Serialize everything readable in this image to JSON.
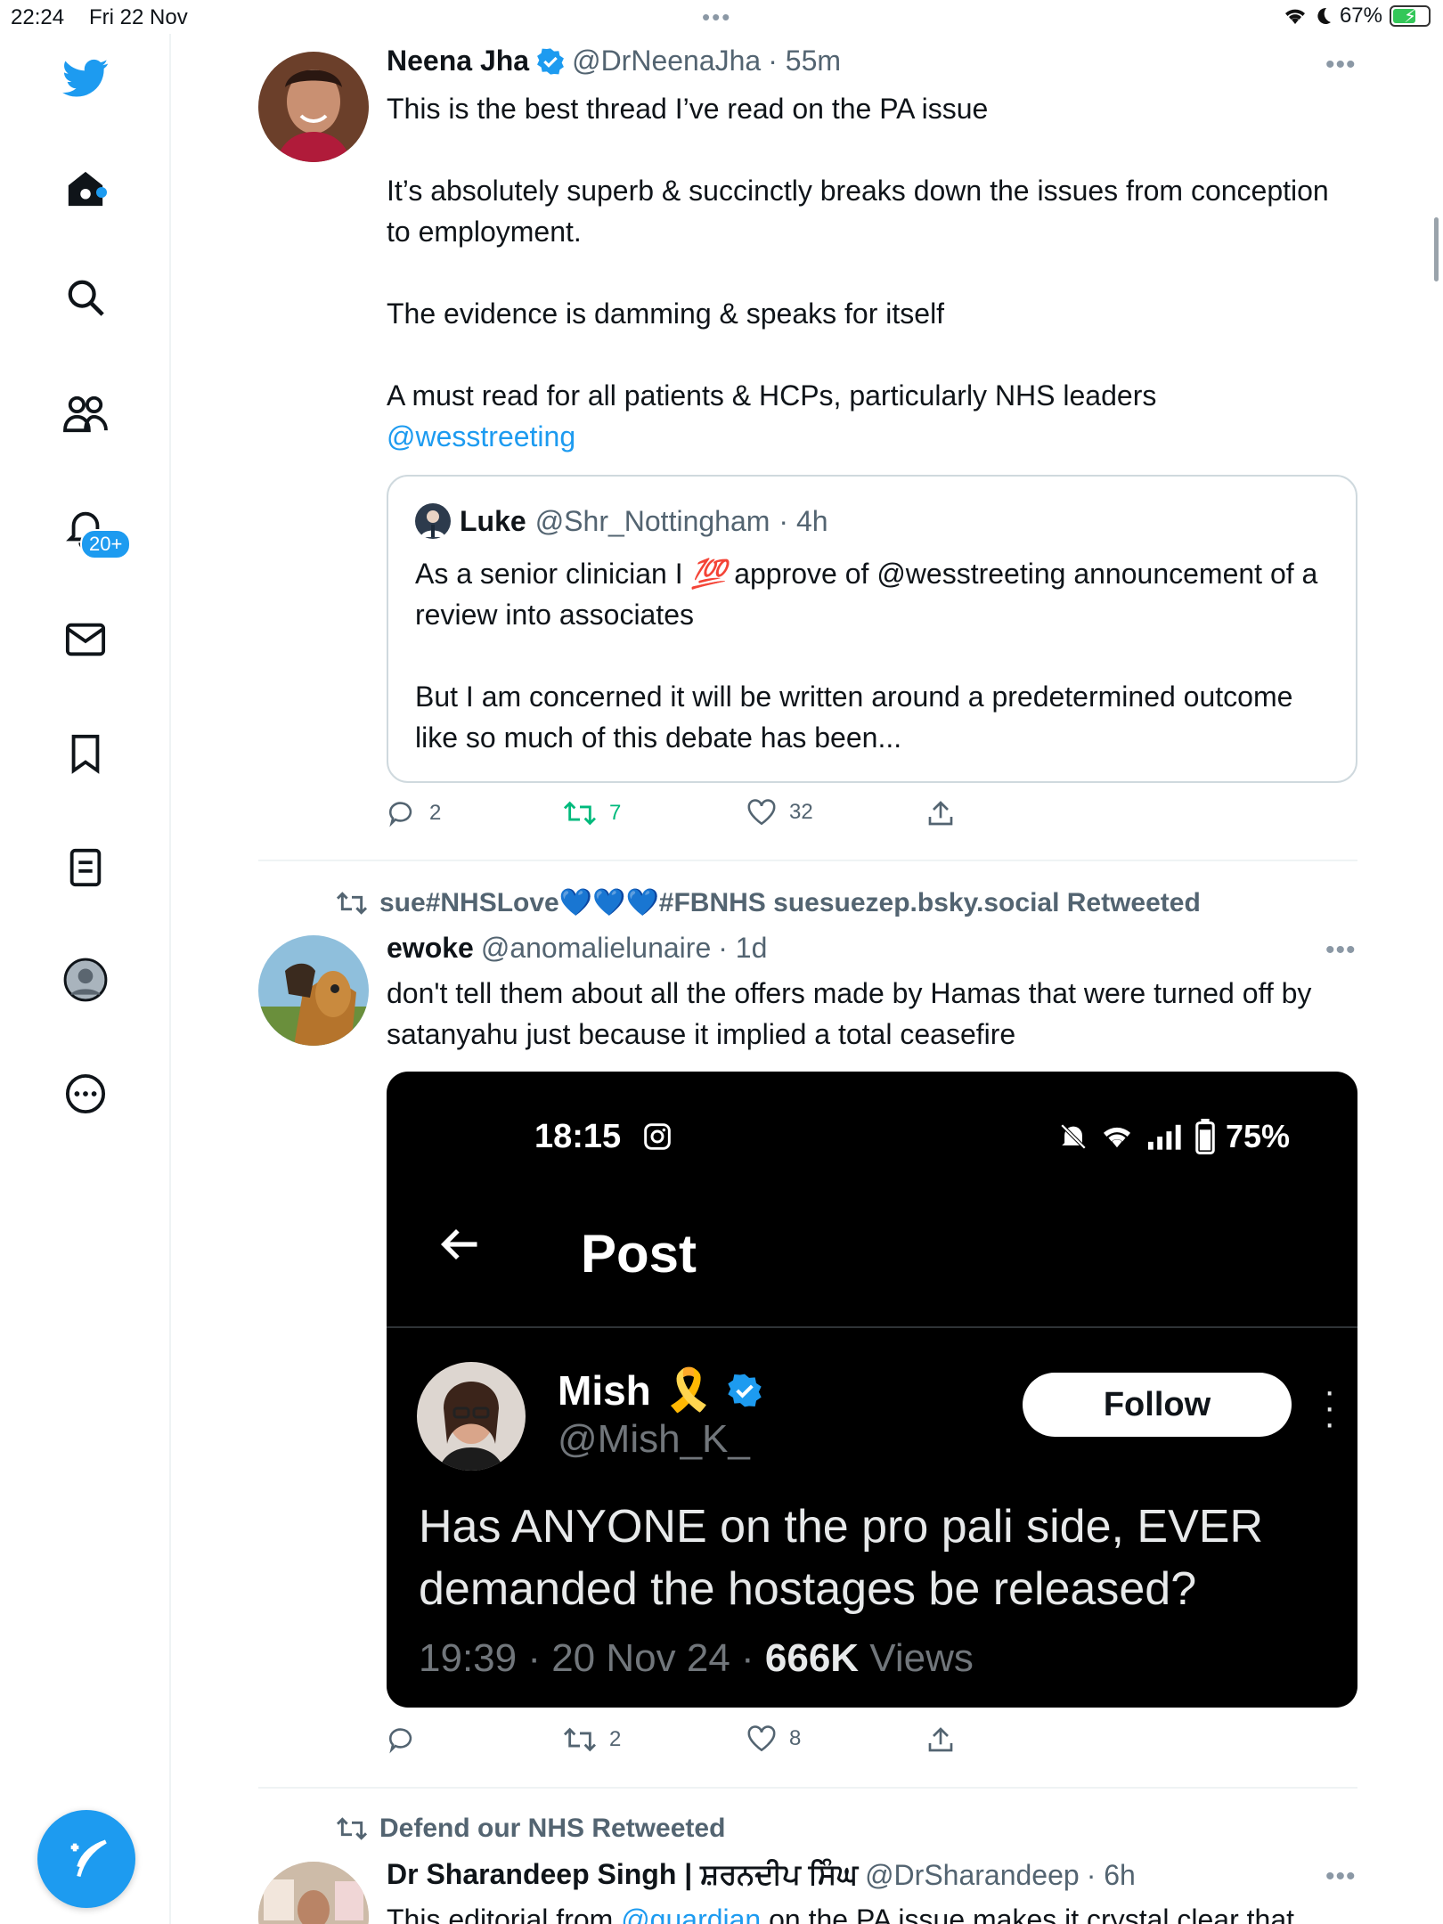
{
  "status_bar": {
    "time": "22:24",
    "date": "Fri 22 Nov",
    "dots": "•••",
    "battery": "67%",
    "battery_level": 0.67
  },
  "sidebar": {
    "notifications_badge": "20+"
  },
  "colors": {
    "brand": "#1d9bf0",
    "retweet_active": "#00ba7c",
    "muted": "#536471"
  },
  "tweets": [
    {
      "name": "Neena Jha",
      "handle": "@DrNeenaJha",
      "time": "· 55m",
      "text": [
        "This is the best thread I’ve read on the PA issue",
        "It’s absolutely superb & succinctly breaks down the issues from conception to employment.",
        "The evidence is damming & speaks for itself",
        "A must read for all patients & HCPs, particularly NHS leaders"
      ],
      "mention": "@wesstreeting",
      "quote": {
        "name": "Luke",
        "handle": "@Shr_Nottingham",
        "time": "· 4h",
        "text_1_pre": "As a senior clinician I ",
        "emoji": "💯",
        "text_1_post": " approve of @wesstreeting announcement of a review into associates",
        "text_2": "But I am concerned it will be written around a predetermined outcome like so much of this debate has been..."
      },
      "replies": "2",
      "retweets": "7",
      "likes": "32"
    },
    {
      "retweeted_by": "sue#NHSLove💙💙💙#FBNHS suesuezep.bsky.social Retweeted",
      "name": "ewoke",
      "handle": "@anomalielunaire",
      "time": "· 1d",
      "text": "don't tell them about all the offers made by Hamas that were turned off by satanyahu just because it implied a total ceasefire",
      "media": {
        "time": "18:15",
        "battery": "75%",
        "title": "Post",
        "name": "Mish",
        "emoji": "🎗️",
        "handle": "@Mish_K_",
        "follow": "Follow",
        "text": "Has ANYONE on the pro pali side, EVER demanded the hostages be released?",
        "meta_pre": "19:39 · 20 Nov 24 · ",
        "views_count": "666K",
        "views_label": " Views"
      },
      "replies": "",
      "retweets": "2",
      "likes": "8"
    },
    {
      "retweeted_by": "Defend our NHS Retweeted",
      "name": "Dr Sharandeep Singh | ਸ਼ਰਨਦੀਪ ਸਿੰਘ",
      "handle": "@DrSharandeep",
      "time": "· 6h",
      "text_pre": "This editorial from ",
      "mention": "@guardian",
      "text_post": " on the PA issue makes it crystal clear that"
    }
  ]
}
